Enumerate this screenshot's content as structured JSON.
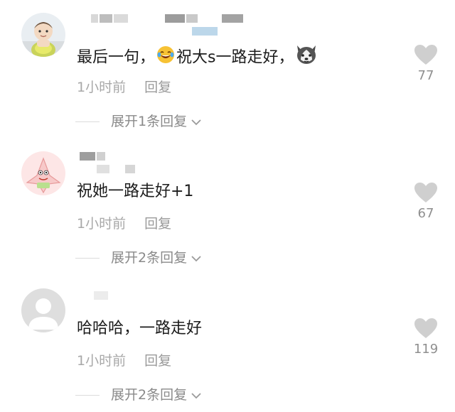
{
  "colors": {
    "text_primary": "#1c1c1c",
    "text_secondary": "#a8a8a8",
    "like_icon": "#cfcfcf",
    "expand_text": "#8a8a8a"
  },
  "comments": [
    {
      "avatar": "baby-photo-avatar",
      "text_before": "最后一句，",
      "emoji_1": "laughing-crying-emoji",
      "text_after": "祝大s一路走好，",
      "emoji_2": "husky-dog-emoji",
      "time": "1小时前",
      "reply_label": "回复",
      "like_count": "77",
      "expand_label": "展开1条回复"
    },
    {
      "avatar": "patrick-star-avatar",
      "text": "祝她一路走好+1",
      "time": "1小时前",
      "reply_label": "回复",
      "like_count": "67",
      "expand_label": "展开2条回复"
    },
    {
      "avatar": "default-user-avatar",
      "text": "哈哈哈，一路走好",
      "time": "1小时前",
      "reply_label": "回复",
      "like_count": "119",
      "expand_label": "展开2条回复"
    }
  ]
}
